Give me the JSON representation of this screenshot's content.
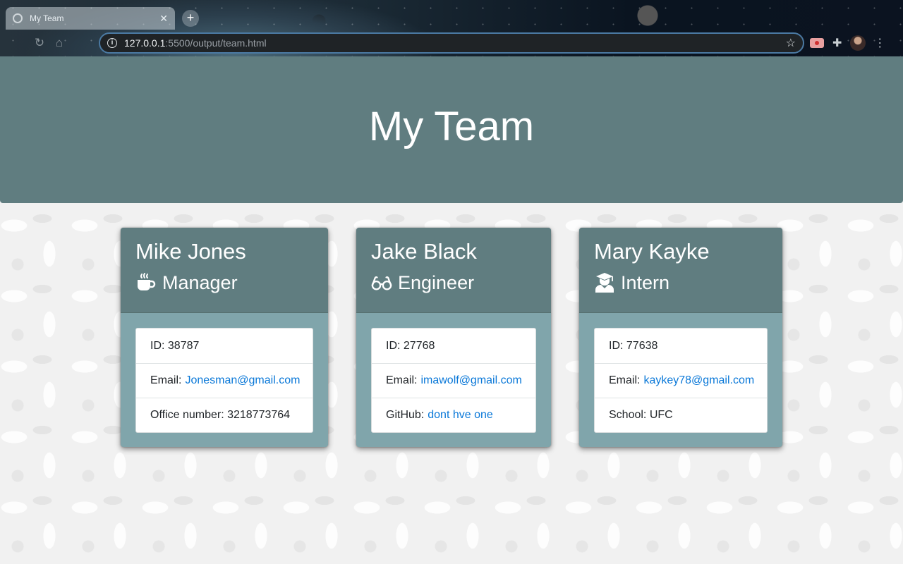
{
  "browser": {
    "tab_title": "My Team",
    "url_host": "127.0.0.1",
    "url_rest": ":5500/output/team.html"
  },
  "page": {
    "title": "My Team"
  },
  "employees": [
    {
      "name": "Mike Jones",
      "role": "Manager",
      "role_icon": "coffee-mug-icon",
      "id_label": "ID: 38787",
      "email_label": "Email:",
      "email": "Jonesman@gmail.com",
      "extra_label": "Office number: 3218773764",
      "extra_value": ""
    },
    {
      "name": "Jake Black",
      "role": "Engineer",
      "role_icon": "glasses-icon",
      "id_label": "ID: 27768",
      "email_label": "Email:",
      "email": "imawolf@gmail.com",
      "extra_label": "GitHub:",
      "extra_value": "dont hve one"
    },
    {
      "name": "Mary Kayke",
      "role": "Intern",
      "role_icon": "graduate-icon",
      "id_label": "ID: 77638",
      "email_label": "Email:",
      "email": "kaykey78@gmail.com",
      "extra_label": "School: UFC",
      "extra_value": ""
    }
  ],
  "colors": {
    "header_bg": "#607d80",
    "card_body_bg": "#80a5ab",
    "link": "#0a78d8"
  }
}
